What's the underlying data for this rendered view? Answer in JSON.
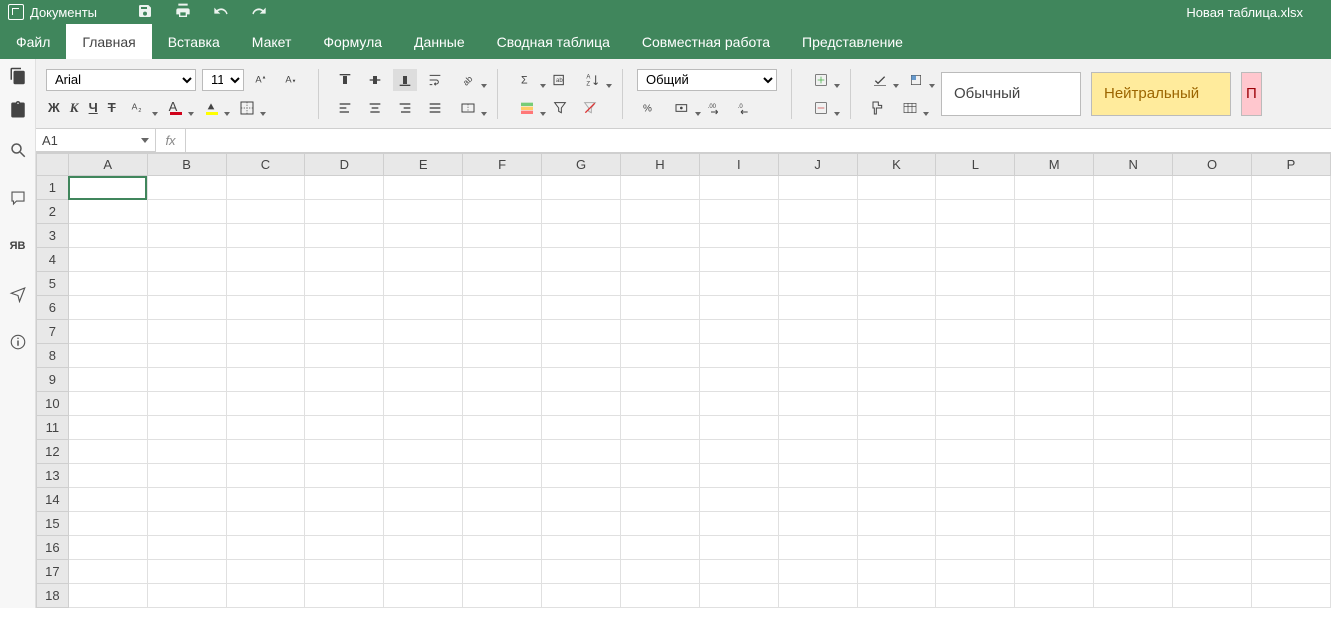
{
  "titlebar": {
    "app_title": "Документы",
    "filename": "Новая таблица.xlsx"
  },
  "menu": {
    "items": [
      "Файл",
      "Главная",
      "Вставка",
      "Макет",
      "Формула",
      "Данные",
      "Сводная таблица",
      "Совместная работа",
      "Представление"
    ],
    "active_index": 1
  },
  "ribbon": {
    "font_name": "Arial",
    "font_size": "11",
    "bold": "Ж",
    "italic": "К",
    "underline": "Ч",
    "strike": "Т",
    "number_format": "Общий",
    "styles": {
      "normal": "Обычный",
      "neutral": "Нейтральный",
      "bad": "П"
    }
  },
  "formula_bar": {
    "cell_ref": "A1",
    "fx": "fx",
    "content": ""
  },
  "grid": {
    "columns": [
      "A",
      "B",
      "C",
      "D",
      "E",
      "F",
      "G",
      "H",
      "I",
      "J",
      "K",
      "L",
      "M",
      "N",
      "O",
      "P"
    ],
    "rows": [
      "1",
      "2",
      "3",
      "4",
      "5",
      "6",
      "7",
      "8",
      "9",
      "10",
      "11",
      "12",
      "13",
      "14",
      "15",
      "16",
      "17",
      "18"
    ],
    "selected": "A1"
  }
}
